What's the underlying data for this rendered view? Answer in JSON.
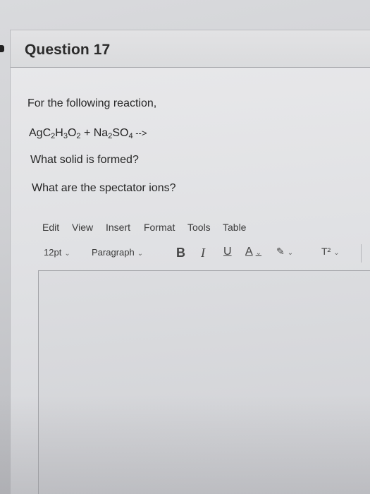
{
  "question": {
    "title": "Question 17",
    "prompt": "For the following reaction,",
    "reaction": {
      "r1": "AgC",
      "r1_sub1": "2",
      "r1_h": "H",
      "r1_sub2": "3",
      "r1_o": "O",
      "r1_sub3": "2",
      "plus": " + ",
      "r2": "Na",
      "r2_sub1": "2",
      "r2_so": "SO",
      "r2_sub2": "4",
      "arrow": " -->"
    },
    "q1": "What solid is formed?",
    "q2": "What are the spectator ions?"
  },
  "editor": {
    "menu": [
      "Edit",
      "View",
      "Insert",
      "Format",
      "Tools",
      "Table"
    ],
    "font_size": "12pt",
    "block_format": "Paragraph",
    "bold": "B",
    "italic": "I",
    "underline": "U",
    "text_color": "A",
    "highlight": "✎",
    "superscript": "T²",
    "body_value": ""
  }
}
